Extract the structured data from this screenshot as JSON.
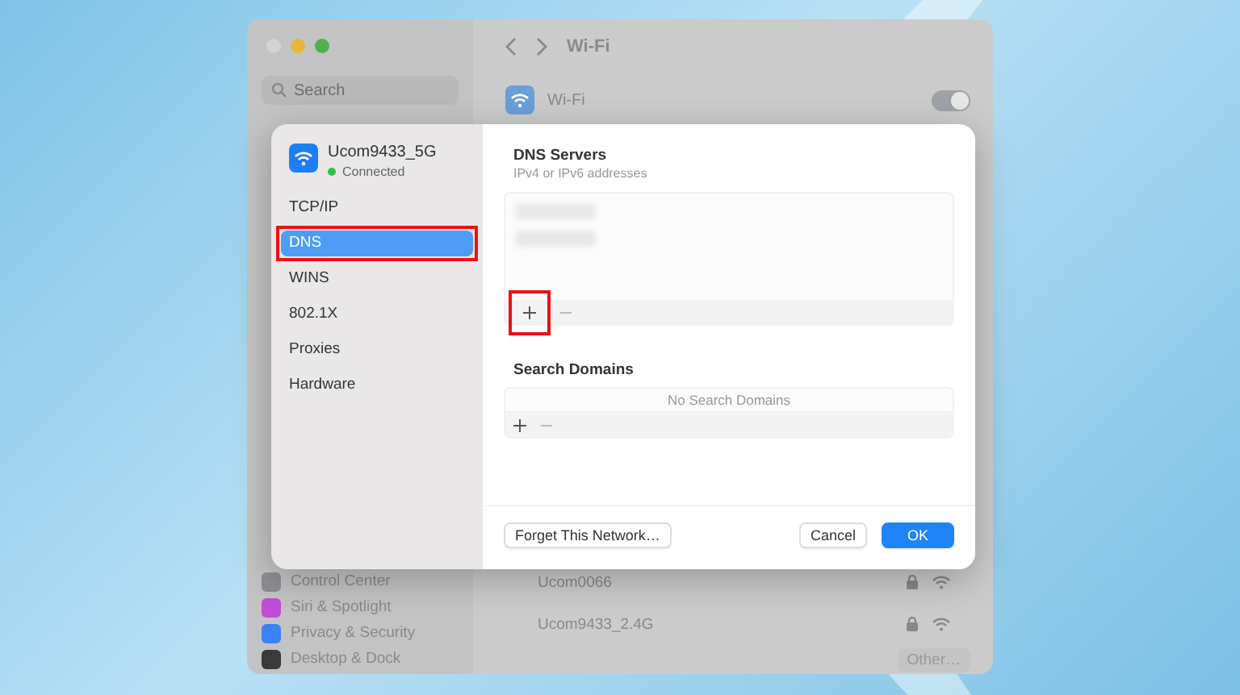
{
  "window": {
    "search": {
      "placeholder": "Search"
    },
    "sidebar": {
      "items": [
        {
          "label": "Control Center",
          "color": "#8e8e93"
        },
        {
          "label": "Siri & Spotlight",
          "color": "#c04fd6"
        },
        {
          "label": "Privacy & Security",
          "color": "#3b82f6"
        },
        {
          "label": "Desktop & Dock",
          "color": "#3a3a3c"
        }
      ]
    },
    "title": "Wi-Fi",
    "wifi": {
      "label": "Wi-Fi",
      "on": true
    },
    "networks": [
      {
        "name": "Ucom0066",
        "locked": true
      },
      {
        "name": "Ucom9433_2.4G",
        "locked": true
      }
    ],
    "other_button": "Other…"
  },
  "dialog": {
    "network": {
      "name": "Ucom9433_5G",
      "status": "Connected",
      "connected": true
    },
    "nav": [
      {
        "label": "TCP/IP",
        "selected": false,
        "highlighted": false
      },
      {
        "label": "DNS",
        "selected": true,
        "highlighted": true
      },
      {
        "label": "WINS",
        "selected": false,
        "highlighted": false
      },
      {
        "label": "802.1X",
        "selected": false,
        "highlighted": false
      },
      {
        "label": "Proxies",
        "selected": false,
        "highlighted": false
      },
      {
        "label": "Hardware",
        "selected": false,
        "highlighted": false
      }
    ],
    "dns_servers": {
      "title": "DNS Servers",
      "subtitle": "IPv4 or IPv6 addresses",
      "add_highlighted": true
    },
    "search_domains": {
      "title": "Search Domains",
      "empty_text": "No Search Domains",
      "add_highlighted": false
    },
    "buttons": {
      "forget": "Forget This Network…",
      "cancel": "Cancel",
      "ok": "OK"
    }
  }
}
